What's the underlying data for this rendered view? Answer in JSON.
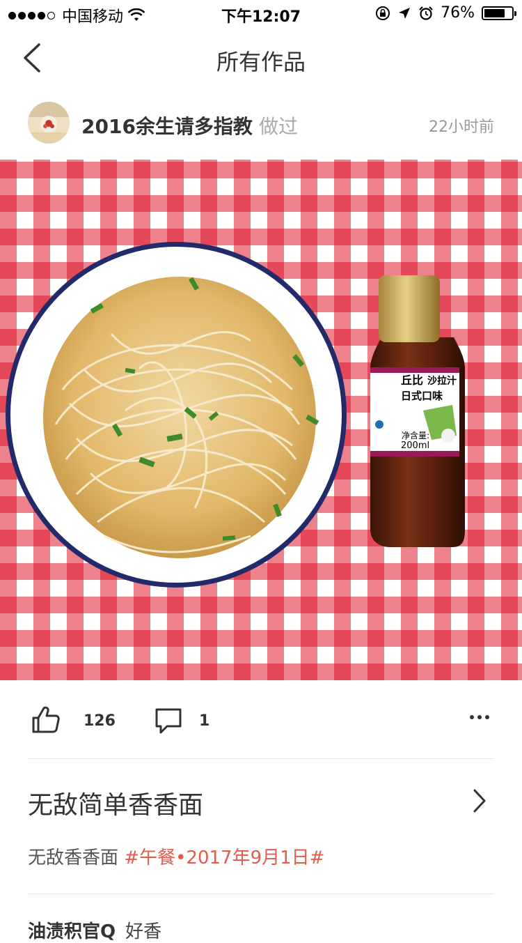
{
  "status_bar": {
    "carrier": "中国移动",
    "time": "下午12:07",
    "battery_text": "76%",
    "battery_level": 0.76,
    "signal_bars": 4,
    "signal_total": 5
  },
  "nav": {
    "title": "所有作品"
  },
  "post": {
    "author": "2016余生请多指教",
    "action": "做过",
    "time_ago": "22小时前",
    "photo_label": {
      "brand": "丘比",
      "name": "沙拉汁",
      "flavor": "日式口味",
      "net_label": "净含量:",
      "net_value": "200ml"
    },
    "likes": "126",
    "comments": "1"
  },
  "recipe": {
    "title": "无敌简单香香面",
    "description": "无敌香香面",
    "tag": "#午餐•2017年9月1日#"
  },
  "comment_preview": {
    "user": "油渍积官Q",
    "text": "好香"
  },
  "colors": {
    "tag": "#e25c4e",
    "tablecloth": "#de1a2e"
  }
}
